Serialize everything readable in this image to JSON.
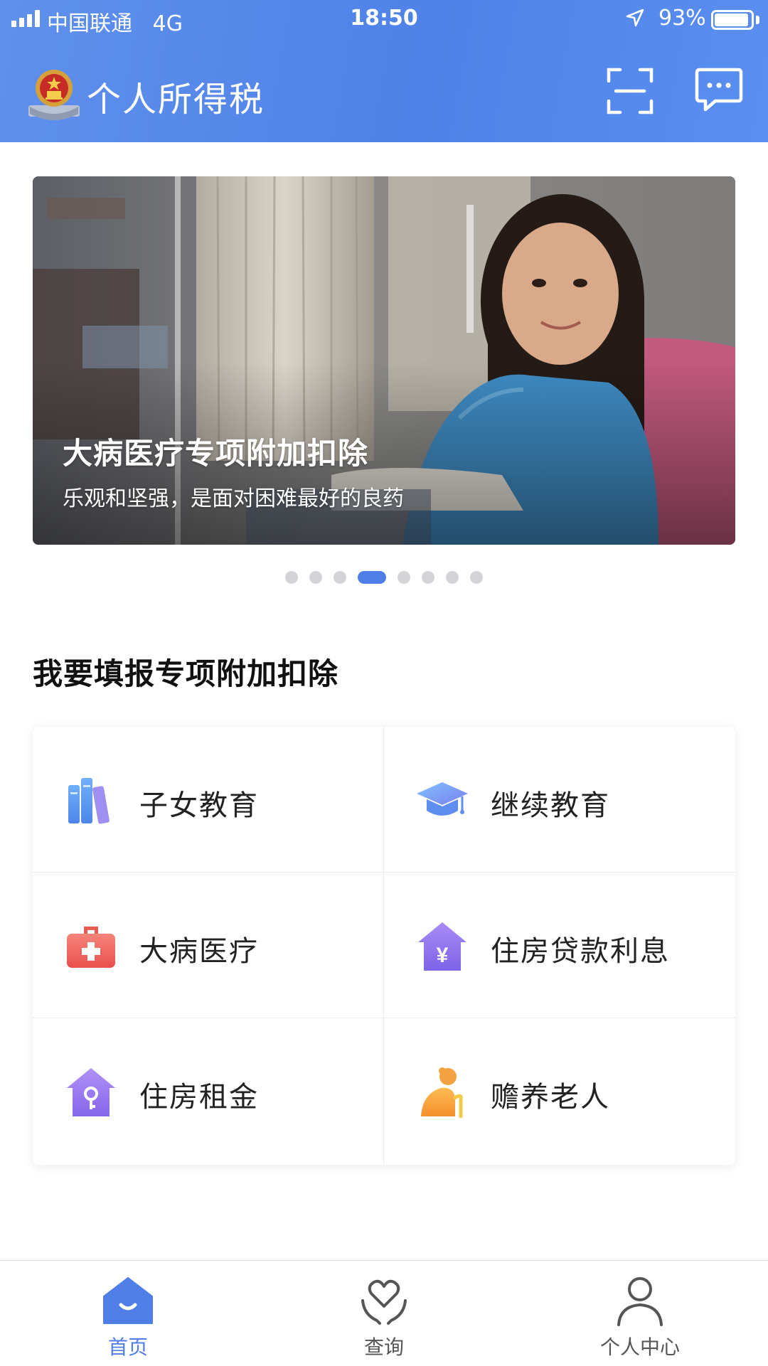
{
  "status_bar": {
    "carrier": "中国联通",
    "network": "4G",
    "time": "18:50",
    "battery_percent": "93%",
    "battery_level": 0.93,
    "location_icon": "location-arrow-icon"
  },
  "app_bar": {
    "title": "个人所得税",
    "logo_icon": "national-emblem-icon",
    "scan_icon": "scan-icon",
    "message_icon": "message-bubble-icon",
    "color": "#5a8aeb"
  },
  "banner": {
    "title": "大病医疗专项附加扣除",
    "subtitle": "乐观和坚强，是面对困难最好的良药",
    "page_count": 8,
    "active_index": 3
  },
  "section": {
    "title": "我要填报专项附加扣除",
    "items": [
      {
        "label": "子女教育",
        "icon": "books-icon"
      },
      {
        "label": "继续教育",
        "icon": "graduation-cap-icon"
      },
      {
        "label": "大病医疗",
        "icon": "medical-kit-icon"
      },
      {
        "label": "住房贷款利息",
        "icon": "house-yuan-icon"
      },
      {
        "label": "住房租金",
        "icon": "house-key-icon"
      },
      {
        "label": "赡养老人",
        "icon": "elderly-person-icon"
      }
    ]
  },
  "tab_bar": {
    "tabs": [
      {
        "label": "首页",
        "icon": "home-icon",
        "active": true
      },
      {
        "label": "查询",
        "icon": "heart-hands-icon",
        "active": false
      },
      {
        "label": "个人中心",
        "icon": "person-icon",
        "active": false
      }
    ],
    "accent_color": "#4f7fe6"
  }
}
